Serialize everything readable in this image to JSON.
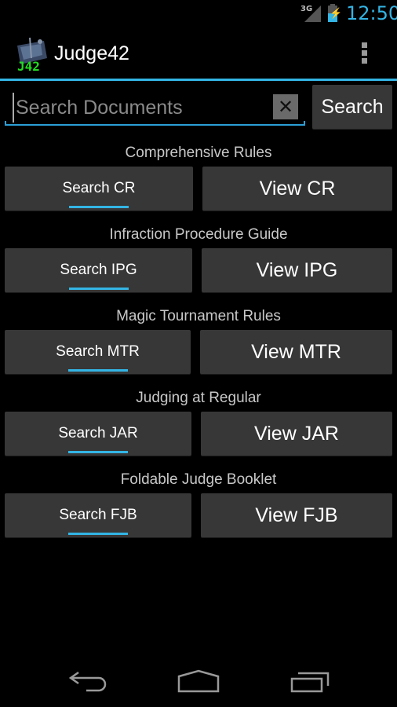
{
  "status_bar": {
    "network": "3G",
    "time": "12:50",
    "icons": [
      "signal-icon",
      "battery-charging-icon"
    ]
  },
  "action_bar": {
    "title": "Judge42",
    "logo_text": "J42",
    "overflow_icon": "overflow-menu-icon"
  },
  "search": {
    "placeholder": "Search Documents",
    "value": "",
    "clear_label": "✕",
    "button_label": "Search"
  },
  "sections": [
    {
      "title": "Comprehensive Rules",
      "search_label": "Search CR",
      "view_label": "View CR"
    },
    {
      "title": "Infraction Procedure Guide",
      "search_label": "Search IPG",
      "view_label": "View IPG"
    },
    {
      "title": "Magic Tournament Rules",
      "search_label": "Search MTR",
      "view_label": "View MTR"
    },
    {
      "title": "Judging at Regular",
      "search_label": "Search JAR",
      "view_label": "View JAR"
    },
    {
      "title": "Foldable Judge Booklet",
      "search_label": "Search FJB",
      "view_label": "View FJB"
    }
  ],
  "nav_bar": {
    "items": [
      "back-icon",
      "home-icon",
      "recent-apps-icon"
    ]
  },
  "colors": {
    "accent": "#33b5e5",
    "button_bg": "#373737",
    "background": "#000000"
  }
}
